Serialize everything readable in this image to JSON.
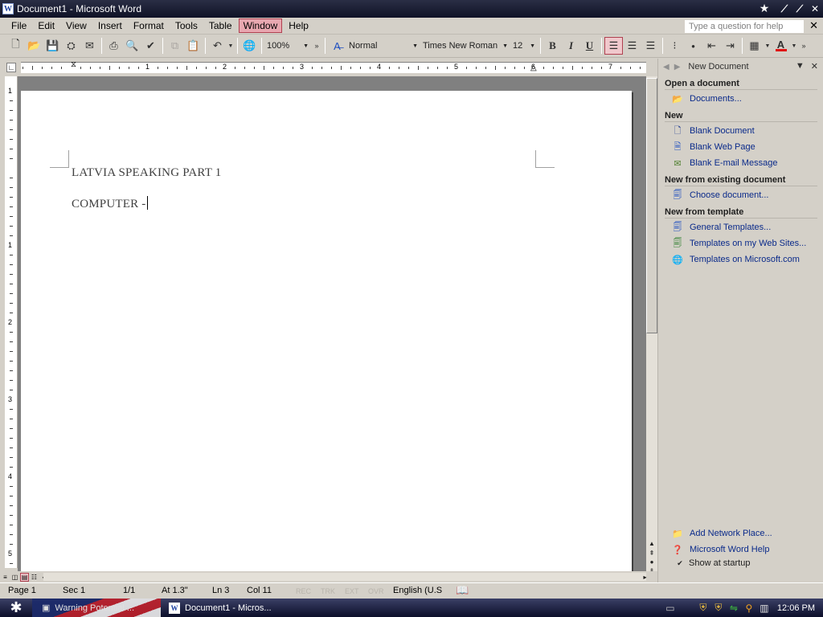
{
  "window": {
    "title": "Document1 - Microsoft Word"
  },
  "menu": {
    "items": [
      "File",
      "Edit",
      "View",
      "Insert",
      "Format",
      "Tools",
      "Table",
      "Window",
      "Help"
    ],
    "active_index": 7,
    "help_placeholder": "Type a question for help"
  },
  "toolbar": {
    "zoom": "100%",
    "style": "Normal",
    "font": "Times New Roman",
    "size": "12",
    "font_color": "#e01010"
  },
  "ruler": {
    "numbers": [
      "1",
      "1",
      "2",
      "3",
      "4",
      "5",
      "6",
      "7"
    ],
    "vnumbers": [
      "1",
      "1",
      "2",
      "3",
      "4",
      "5"
    ]
  },
  "document": {
    "lines": [
      "LATVIA SPEAKING PART 1",
      "COMPUTER -"
    ]
  },
  "taskpane": {
    "title": "New Document",
    "sections": {
      "open": "Open a document",
      "new": "New",
      "existing": "New from existing document",
      "template": "New from template"
    },
    "open_links": [
      {
        "label": "Documents...",
        "icon": "folder-open-icon"
      }
    ],
    "new_links": [
      {
        "label": "Blank Document",
        "icon": "blank-document-icon"
      },
      {
        "label": "Blank Web Page",
        "icon": "web-page-icon"
      },
      {
        "label": "Blank E-mail Message",
        "icon": "email-icon"
      }
    ],
    "existing_links": [
      {
        "label": "Choose document...",
        "icon": "document-word-icon"
      }
    ],
    "template_links": [
      {
        "label": "General Templates...",
        "icon": "template-icon"
      },
      {
        "label": "Templates on my Web Sites...",
        "icon": "web-templates-icon"
      },
      {
        "label": "Templates on Microsoft.com",
        "icon": "globe-icon"
      }
    ],
    "bottom_links": [
      {
        "label": "Add Network Place...",
        "icon": "network-folder-icon"
      },
      {
        "label": "Microsoft Word Help",
        "icon": "help-icon"
      }
    ],
    "show_at_startup": "Show at startup",
    "show_at_startup_checked": true
  },
  "status": {
    "page": "Page 1",
    "sec": "Sec 1",
    "pages": "1/1",
    "at": "At 1.3\"",
    "ln": "Ln 3",
    "col": "Col 11",
    "rec": "REC",
    "trk": "TRK",
    "ext": "EXT",
    "ovr": "OVR",
    "language": "English (U.S"
  },
  "taskbar": {
    "tasks": [
      "Warning Potential ...",
      "Document1 - Micros..."
    ],
    "clock": "12:06 PM"
  }
}
